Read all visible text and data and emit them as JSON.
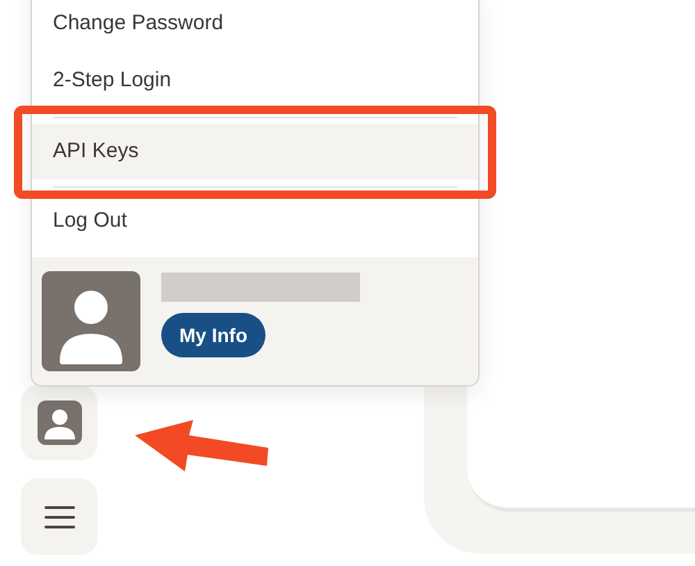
{
  "account_menu": {
    "items": [
      {
        "label": "Change Password",
        "selected": false
      },
      {
        "label": "2-Step Login",
        "selected": false
      },
      {
        "label": "API Keys",
        "selected": true
      },
      {
        "label": "Log Out",
        "selected": false
      }
    ],
    "profile": {
      "button": "My Info"
    }
  }
}
